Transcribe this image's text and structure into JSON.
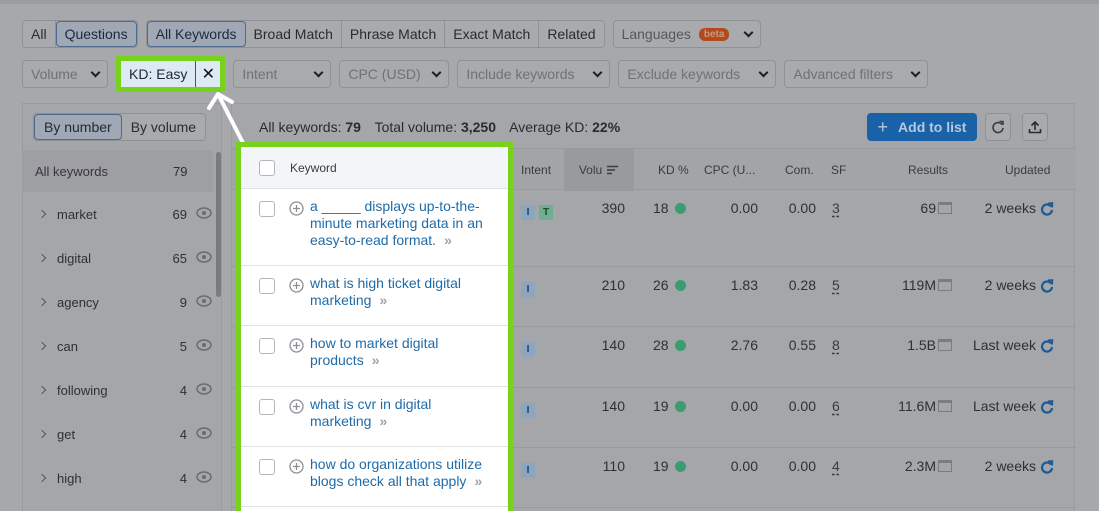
{
  "tabs_row1": {
    "scope": [
      "All",
      "Questions"
    ],
    "scope_active": "Questions",
    "match": [
      "All Keywords",
      "Broad Match",
      "Phrase Match",
      "Exact Match",
      "Related"
    ],
    "match_active": "All Keywords",
    "languages": {
      "label": "Languages",
      "badge": "beta"
    }
  },
  "filters": {
    "volume": "Volume",
    "kd": "KD: Easy",
    "kd_clear": "✕",
    "intent": "Intent",
    "cpc": "CPC (USD)",
    "include": "Include keywords",
    "exclude": "Exclude keywords",
    "advanced": "Advanced filters"
  },
  "left_panel": {
    "toggle": [
      "By number",
      "By volume"
    ],
    "toggle_active": "By number",
    "all_label": "All keywords",
    "all_count": "79",
    "groups": [
      {
        "label": "market",
        "count": "69"
      },
      {
        "label": "digital",
        "count": "65"
      },
      {
        "label": "agency",
        "count": "9"
      },
      {
        "label": "can",
        "count": "5"
      },
      {
        "label": "following",
        "count": "4"
      },
      {
        "label": "get",
        "count": "4"
      },
      {
        "label": "high",
        "count": "4"
      }
    ]
  },
  "summary": {
    "all_label": "All keywords:",
    "all_value": "79",
    "volume_label": "Total volume:",
    "volume_value": "3,250",
    "kd_label": "Average KD:",
    "kd_value": "22%"
  },
  "toolbar": {
    "add_plus": "+",
    "add_label": "Add to list"
  },
  "table": {
    "columns": {
      "keyword": "Keyword",
      "intent": "Intent",
      "volume": "Volu",
      "kd": "KD %",
      "cpc": "CPC (U...",
      "com": "Com.",
      "sf": "SF",
      "results": "Results",
      "updated": "Updated"
    },
    "rows": [
      {
        "keyword": "a _____ displays up-to-the-minute marketing data in an easy-to-read format.",
        "intents": [
          "I",
          "T"
        ],
        "volume": "390",
        "kd": "18",
        "cpc": "0.00",
        "com": "0.00",
        "sf": "3",
        "results": "69",
        "updated": "2 weeks"
      },
      {
        "keyword": "what is high ticket digital marketing",
        "intents": [
          "I"
        ],
        "volume": "210",
        "kd": "26",
        "cpc": "1.83",
        "com": "0.28",
        "sf": "5",
        "results": "119M",
        "updated": "2 weeks"
      },
      {
        "keyword": "how to market digital products",
        "intents": [
          "I"
        ],
        "volume": "140",
        "kd": "28",
        "cpc": "2.76",
        "com": "0.55",
        "sf": "8",
        "results": "1.5B",
        "updated": "Last week"
      },
      {
        "keyword": "what is cvr in digital marketing",
        "intents": [
          "I"
        ],
        "volume": "140",
        "kd": "19",
        "cpc": "0.00",
        "com": "0.00",
        "sf": "6",
        "results": "11.6M",
        "updated": "Last week"
      },
      {
        "keyword": "how do organizations utilize blogs check all that apply",
        "intents": [
          "I"
        ],
        "volume": "110",
        "kd": "19",
        "cpc": "0.00",
        "com": "0.00",
        "sf": "4",
        "results": "2.3M",
        "updated": "2 weeks"
      }
    ],
    "more_glyph": "»"
  },
  "colors": {
    "highlight": "#76d21b",
    "accent": "#1a62a8",
    "kd_easy": "#3b9c70",
    "keyword_link": "#1f6ba8"
  }
}
